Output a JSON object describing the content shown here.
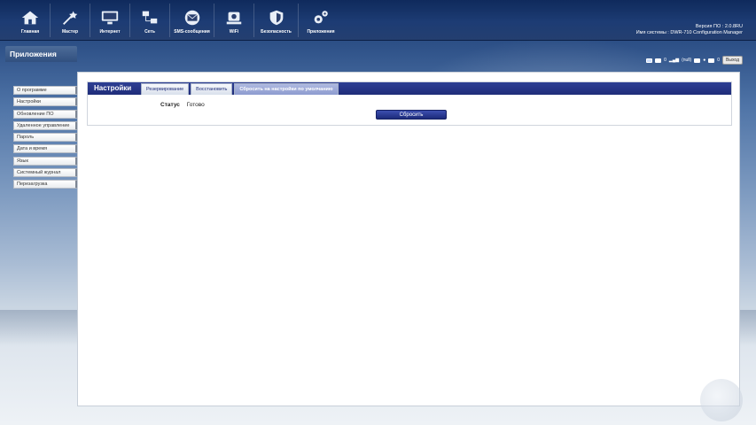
{
  "nav": {
    "items": [
      {
        "label": "Главная",
        "icon": "home-icon"
      },
      {
        "label": "Мастер",
        "icon": "wizard-icon"
      },
      {
        "label": "Интернет",
        "icon": "monitor-icon"
      },
      {
        "label": "Сеть",
        "icon": "network-icon"
      },
      {
        "label": "SMS-сообщения",
        "icon": "envelope-icon"
      },
      {
        "label": "WiFi",
        "icon": "wifi-icon"
      },
      {
        "label": "Безопасность",
        "icon": "shield-icon"
      },
      {
        "label": "Приложения",
        "icon": "gears-icon"
      }
    ]
  },
  "system": {
    "version_line": "Версия ПО : 2.0.8RU",
    "name_line": "Имя системы : DWR-710 Configuration Manager"
  },
  "section": {
    "title": "Приложения"
  },
  "statusbar": {
    "sms_count": "0",
    "signal": "(null)",
    "mail_count": "0",
    "logout": "Выход"
  },
  "sidebar": {
    "items": [
      {
        "label": "О программе"
      },
      {
        "label": "Настройки"
      },
      {
        "label": "Обновление ПО"
      },
      {
        "label": "Удаленное управление"
      },
      {
        "label": "Пароль"
      },
      {
        "label": "Дата и время"
      },
      {
        "label": "Язык"
      },
      {
        "label": "Системный журнал"
      },
      {
        "label": "Перезагрузка"
      }
    ]
  },
  "panel": {
    "title": "Настройки",
    "tabs": [
      {
        "label": "Резервирование"
      },
      {
        "label": "Восстановить"
      },
      {
        "label": "Сбросить на настройки по умолчанию"
      }
    ],
    "status_label": "Статус",
    "status_value": "Готово",
    "reset_button": "Сбросить"
  },
  "colors": {
    "topbar": "#1d3c74",
    "panel_header": "#2e3f94",
    "button": "#2a3a96"
  }
}
